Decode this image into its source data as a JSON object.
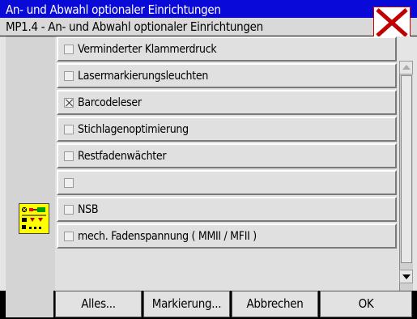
{
  "window": {
    "title": "An- und Abwahl optionaler Einrichtungen",
    "subtitle": "MP1.4 - An- und Abwahl optionaler Einrichtungen",
    "close_icon": "close-x-icon"
  },
  "list": {
    "items": [
      {
        "label": "Verminderter Klammerdruck",
        "checked": false
      },
      {
        "label": "Lasermarkierungsleuchten",
        "checked": false
      },
      {
        "label": "Barcodeleser",
        "checked": true
      },
      {
        "label": "Stichlagenoptimierung",
        "checked": false
      },
      {
        "label": "Restfadenwächter",
        "checked": false
      },
      {
        "label": "",
        "checked": false
      },
      {
        "label": "NSB",
        "checked": false
      },
      {
        "label": "mech. Fadenspannung ( MMII / MFII )",
        "checked": false
      }
    ]
  },
  "side_icon": "selection-list-icon",
  "buttons": {
    "all": "Alles...",
    "mark": "Markierung...",
    "cancel": "Abbrechen",
    "ok": "OK"
  },
  "colors": {
    "title_bar": "#0a0ad8",
    "close_x": "#c00000",
    "icon_bg": "#ffff00"
  }
}
